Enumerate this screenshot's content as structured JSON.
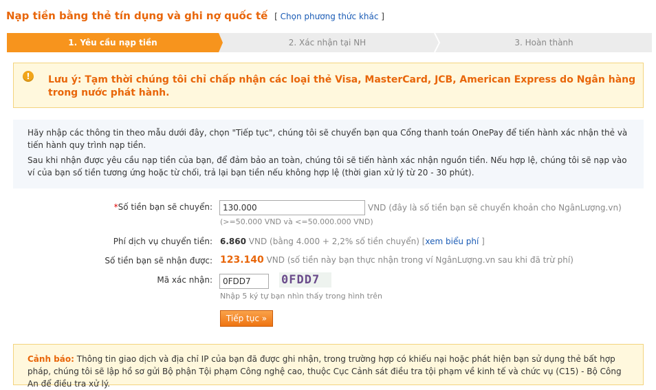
{
  "header": {
    "title": "Nạp tiền bằng thẻ tín dụng và ghi nợ quốc tế",
    "alt_open": "[",
    "alt_link": "Chọn phương thức khác",
    "alt_close": "]"
  },
  "steps": [
    {
      "label": "1.   Yêu cầu nạp tiền",
      "active": true
    },
    {
      "label": "2.   Xác nhận tại NH",
      "active": false
    },
    {
      "label": "3.   Hoàn thành",
      "active": false
    }
  ],
  "notice": {
    "icon": "exclamation-icon",
    "text": "Lưu ý: Tạm thời chúng tôi chỉ chấp nhận các loại thẻ Visa, MasterCard, JCB, American Express do Ngân hàng trong nước phát hành."
  },
  "info": {
    "p1": "Hãy nhập các thông tin theo mẫu dưới đây, chọn \"Tiếp tục\", chúng tôi sẽ chuyển bạn qua Cổng thanh toán OnePay để tiến hành xác nhận thẻ và tiến hành quy trình nạp tiền.",
    "p2": "Sau khi nhận được yêu cầu nạp tiền của bạn, để đảm bảo an toàn, chúng tôi sẽ tiến hành xác nhận nguồn tiền. Nếu hợp lệ, chúng tôi sẽ nạp vào ví của bạn số tiền tương ứng hoặc từ chối, trả lại bạn tiền nếu không hợp lệ (thời gian xử lý từ 20 - 30 phút)."
  },
  "form": {
    "amount": {
      "required_mark": "*",
      "label": "Số tiền bạn sẽ chuyển:",
      "value": "130.000",
      "unit_note": "VND (đây là số tiền bạn sẽ chuyển khoản cho NgânLượng.vn)",
      "range_hint": "(>=50.000 VND và <=50.000.000 VND)"
    },
    "fee": {
      "label": "Phí dịch vụ chuyển tiền:",
      "value": "6.860",
      "note": "VND (bằng 4.000 + 2,2% số tiền chuyển) [",
      "link": "xem biểu phí",
      "close": "]"
    },
    "receive": {
      "label": "Số tiền bạn sẽ nhận được:",
      "value": "123.140",
      "note": "VND (số tiền này bạn thực nhận trong ví NgânLượng.vn sau khi đã trừ phí)"
    },
    "captcha": {
      "label": "Mã xác nhận:",
      "value": "0FDD7",
      "image_text": "0FDD7",
      "hint": "Nhập 5 ký tự bạn nhìn thấy trong hình trên"
    },
    "submit_label": "Tiếp tục »"
  },
  "warning": {
    "label": "Cảnh báo:",
    "text": "Thông tin giao dịch và địa chỉ IP của bạn đã được ghi nhận, trong trường hợp có khiếu nại hoặc phát hiện bạn sử dụng thẻ bất hợp pháp, chúng tôi sẽ lập hồ sơ gửi Bộ phận Tội phạm Công nghệ cao, thuộc Cục Cảnh sát điều tra tội phạm về kinh tế và chức vụ (C15) - Bộ Công An để điều tra xử lý."
  },
  "colors": {
    "accent": "#e8660a",
    "step_active": "#f7941d",
    "step_inactive": "#ececec",
    "link": "#1a5bb5",
    "notice_bg": "#fff8dd",
    "info_bg": "#f4f7fb"
  }
}
